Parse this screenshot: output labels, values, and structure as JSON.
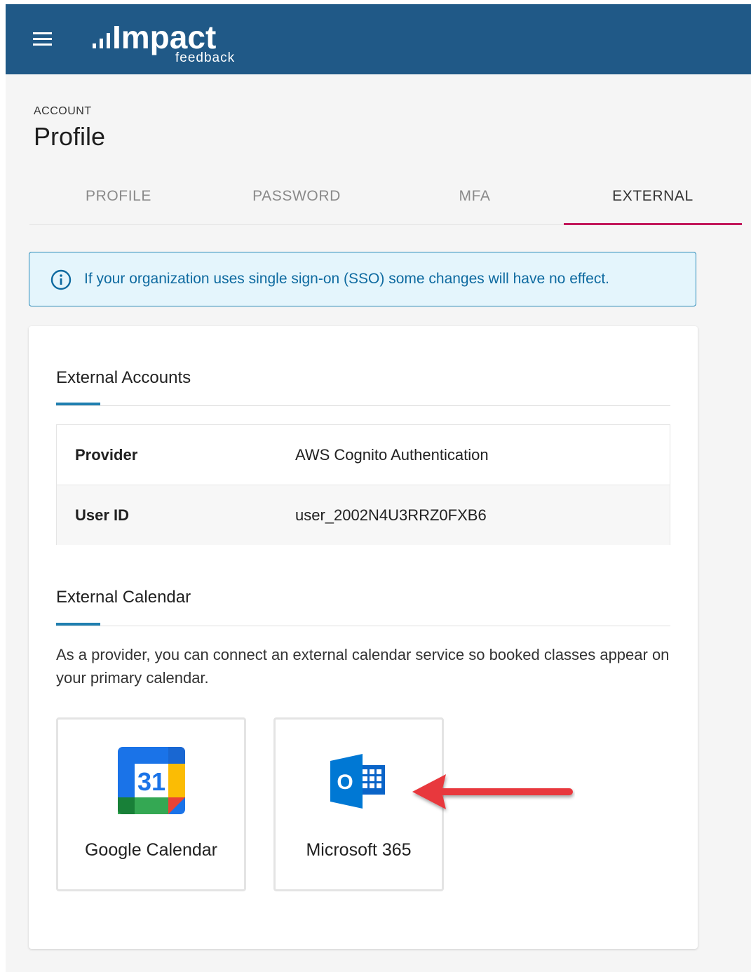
{
  "header": {
    "menu_icon": "hamburger-menu-icon",
    "logo_text": "Impact",
    "logo_subtext": "feedback",
    "bar_color": "#205987"
  },
  "page": {
    "overline": "ACCOUNT",
    "title": "Profile"
  },
  "tabs": [
    {
      "label": "PROFILE",
      "active": false
    },
    {
      "label": "PASSWORD",
      "active": false
    },
    {
      "label": "MFA",
      "active": false
    },
    {
      "label": "EXTERNAL",
      "active": true
    }
  ],
  "alert": {
    "icon": "info-icon",
    "text": "If your organization uses single sign-on (SSO) some changes will have no effect."
  },
  "external_accounts": {
    "title": "External Accounts",
    "rows": [
      {
        "label": "Provider",
        "value": "AWS Cognito Authentication"
      },
      {
        "label": "User ID",
        "value": "user_2002N4U3RRZ0FXB6"
      }
    ]
  },
  "external_calendar": {
    "title": "External Calendar",
    "description": "As a provider, you can connect an external calendar service so booked classes appear on your primary calendar.",
    "options": [
      {
        "label": "Google Calendar",
        "icon": "google-calendar-icon",
        "icon_text": "31"
      },
      {
        "label": "Microsoft 365",
        "icon": "microsoft-outlook-icon",
        "icon_text": "O"
      }
    ]
  },
  "colors": {
    "active_tab_underline": "#c2185b",
    "section_accent": "#1f7fb0",
    "alert_text": "#0e6aa0",
    "annotation_arrow": "#e8383d"
  }
}
